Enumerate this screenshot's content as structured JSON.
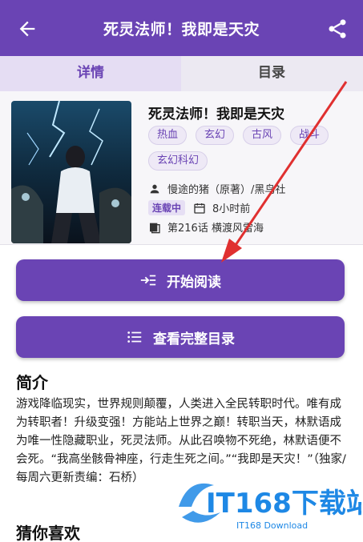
{
  "appbar": {
    "title": "死灵法师！我即是天灾"
  },
  "tabs": [
    {
      "label": "详情"
    },
    {
      "label": "目录"
    }
  ],
  "book": {
    "title": "死灵法师！我即是天灾",
    "tags": [
      "热血",
      "玄幻",
      "古风",
      "战斗",
      "玄幻科幻"
    ],
    "author": "慢途的猪（原著）/黑鸟社",
    "status_badge": "连载中",
    "update": "8小时前",
    "latest_chapter": "第216话 横渡风雷海"
  },
  "buttons": {
    "read": "开始阅读",
    "catalog": "查看完整目录"
  },
  "sections": {
    "intro_title": "简介",
    "recommend_title": "猜你喜欢"
  },
  "intro_text": "游戏降临现实，世界规则颠覆，人类进入全民转职时代。唯有成为转职者！升级变强！方能站上世界之巅！转职当天，林默语成为唯一性隐藏职业，死灵法师。从此召唤物不死绝，林默语便不会死。“我高坐骸骨神座，行走生死之间。”“我即是天灾！”（独家/每周六更新责编：石桥）",
  "watermark": {
    "brand": "IT168下载站",
    "sub": "IT168 Download"
  },
  "colors": {
    "primary": "#6a44b4",
    "annotation_arrow": "#e03030"
  }
}
